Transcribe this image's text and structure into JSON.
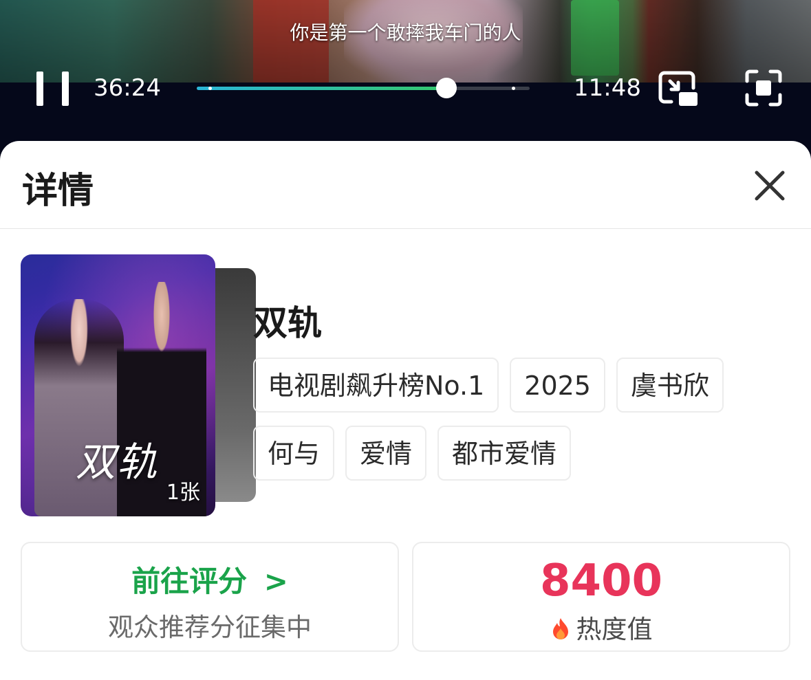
{
  "player": {
    "subtitle": "你是第一个敢摔我车门的人",
    "current_time": "36:24",
    "total_time": "11:48",
    "progress": 0.75,
    "progress_dots": [
      0.04,
      0.95
    ],
    "accent_start": "#2bb6d8",
    "accent_end": "#34c86e",
    "icons": [
      "pause-icon",
      "picture-in-picture-icon",
      "fullscreen-icon"
    ]
  },
  "sheet": {
    "title": "详情",
    "close_icon": "close-icon"
  },
  "drama": {
    "poster_logo": "双轨",
    "poster_count": "1张",
    "title": "双轨",
    "tags": [
      "电视剧飙升榜No.1",
      "2025",
      "虞书欣",
      "何与",
      "爱情",
      "都市爱情"
    ]
  },
  "rating": {
    "link_label": "前往评分",
    "link_arrow": ">",
    "subtitle": "观众推荐分征集中",
    "color": "#1aa34a"
  },
  "heat": {
    "value": "8400",
    "label": "热度值",
    "icon": "flame-icon",
    "color": "#e8345a"
  }
}
